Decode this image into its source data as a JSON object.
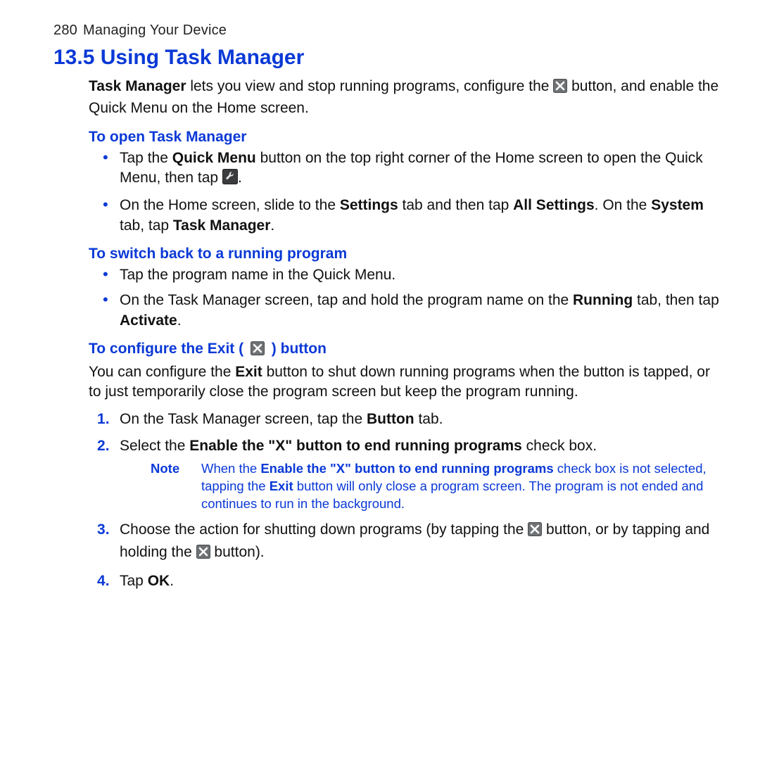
{
  "header": {
    "page_number": "280",
    "chapter": "Managing Your Device"
  },
  "section": {
    "number": "13.5",
    "title": "Using Task Manager"
  },
  "intro": {
    "p1a": "Task Manager",
    "p1b": " lets you view and stop running programs, configure the ",
    "p1c": " button, and enable the Quick Menu on the Home screen."
  },
  "sub1": {
    "heading": "To open Task Manager",
    "b1a": "Tap the ",
    "b1b": "Quick Menu",
    "b1c": " button on the top right corner of the Home screen to open the Quick Menu, then tap ",
    "b1d": ".",
    "b2a": "On the Home screen, slide to the ",
    "b2b": "Settings",
    "b2c": " tab and then tap ",
    "b2d": "All Settings",
    "b2e": ". On the ",
    "b2f": "System",
    "b2g": " tab, tap ",
    "b2h": "Task Manager",
    "b2i": "."
  },
  "sub2": {
    "heading": "To switch back to a running program",
    "b1": "Tap the program name in the Quick Menu.",
    "b2a": "On the Task Manager screen, tap and hold the program name on the ",
    "b2b": "Running",
    "b2c": " tab, then tap ",
    "b2d": "Activate",
    "b2e": "."
  },
  "sub3": {
    "heading_a": "To configure the Exit ( ",
    "heading_b": " ) button",
    "p1a": "You can configure the ",
    "p1b": "Exit",
    "p1c": " button to shut down running programs when the button is tapped, or to just temporarily close the program screen but keep the program running.",
    "s1a": "On the Task Manager screen, tap the ",
    "s1b": "Button",
    "s1c": " tab.",
    "s2a": "Select the ",
    "s2b": "Enable the \"X\" button to end running programs",
    "s2c": " check box.",
    "note_label": "Note",
    "note_a": "When the ",
    "note_b": "Enable the \"X\" button to end running programs",
    "note_c": " check box is not selected, tapping the ",
    "note_d": "Exit",
    "note_e": " button will only close a program screen. The program is not ended and continues to run in the background.",
    "s3a": "Choose the action for shutting down programs (by tapping the ",
    "s3b": " button, or by tapping and holding the ",
    "s3c": " button).",
    "s4a": "Tap ",
    "s4b": "OK",
    "s4c": "."
  }
}
